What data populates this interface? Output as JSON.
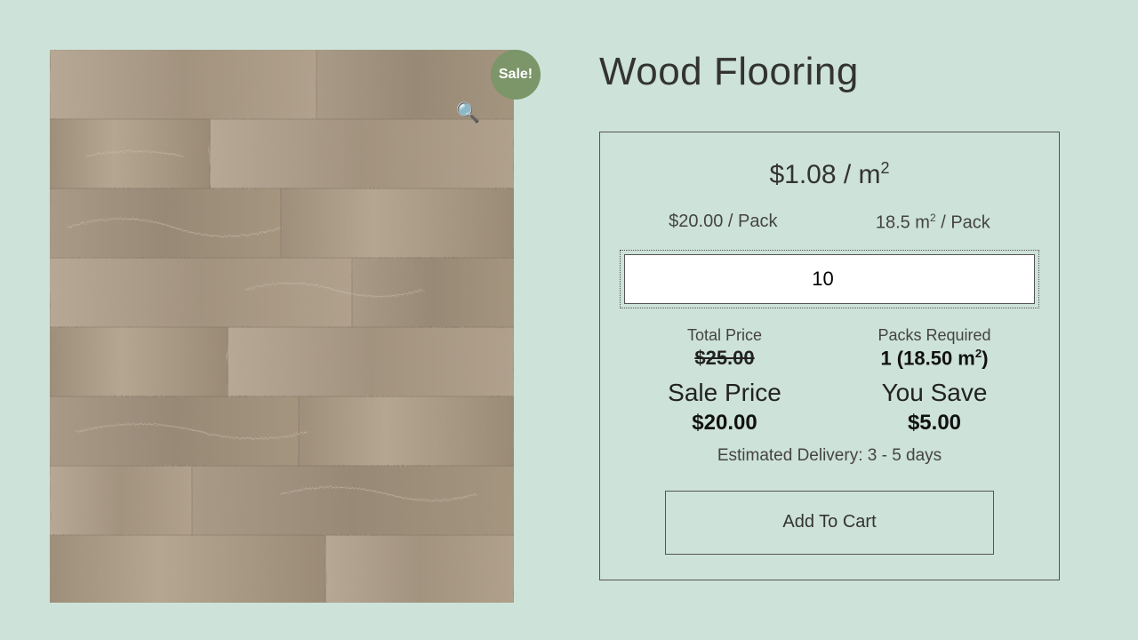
{
  "badge": {
    "sale": "Sale!"
  },
  "product": {
    "title": "Wood Flooring",
    "unit_price": "$1.08 / m²",
    "price_per_pack": "$20.00 / Pack",
    "area_per_pack": "18.5 m² / Pack",
    "qty_value": "10",
    "totals": {
      "total_label": "Total Price",
      "original_total": "$25.00",
      "sale_label": "Sale Price",
      "sale_total": "$20.00",
      "packs_label": "Packs Required",
      "packs_value": "1 (18.50 m²)",
      "save_label": "You Save",
      "save_value": "$5.00"
    },
    "delivery": "Estimated Delivery: 3 - 5 days",
    "add_to_cart": "Add To Cart"
  },
  "icons": {
    "zoom": "🔍"
  }
}
